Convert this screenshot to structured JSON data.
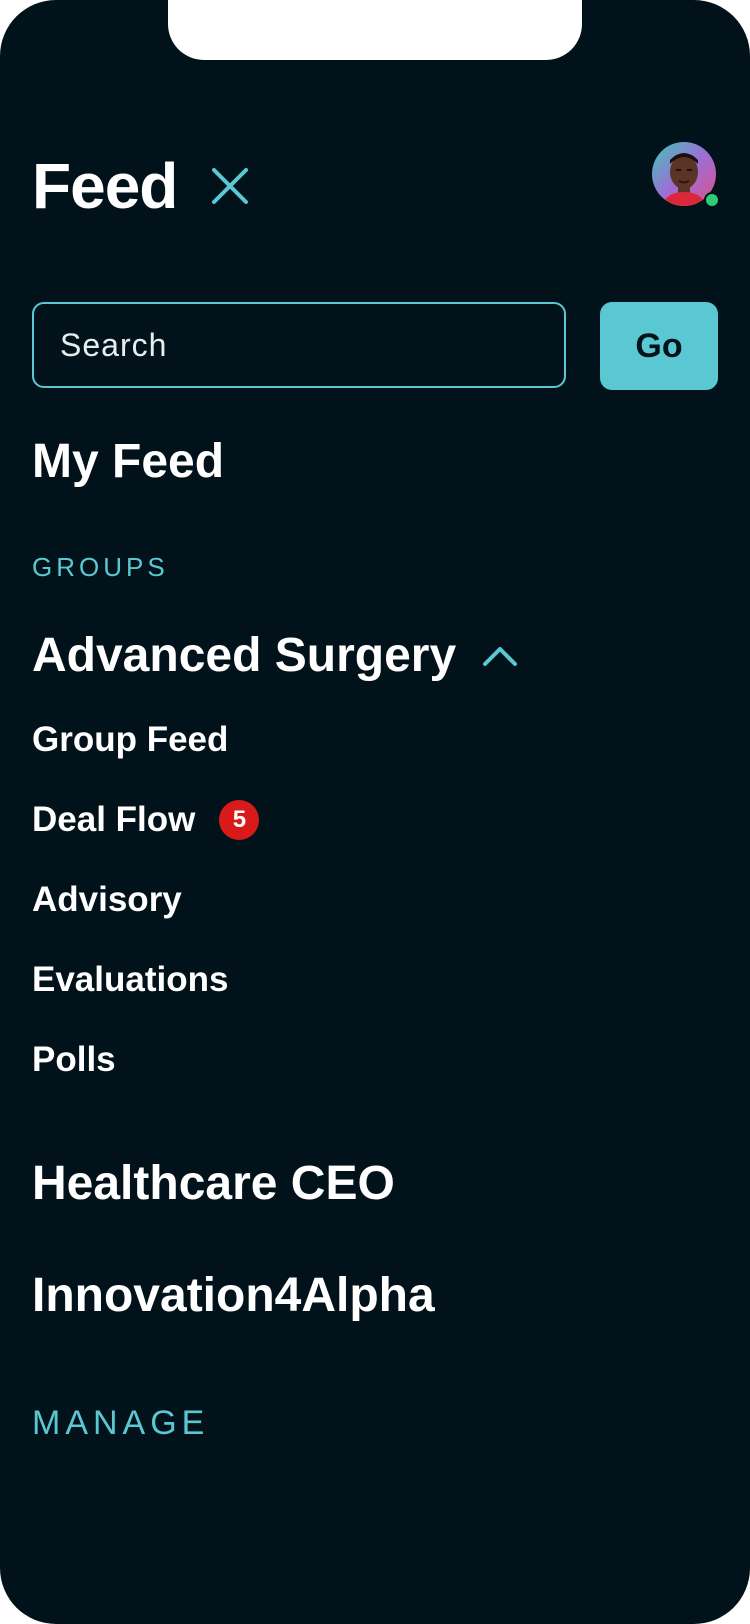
{
  "header": {
    "title": "Feed",
    "close_icon": "close-icon",
    "avatar": {
      "icon": "user-avatar",
      "status": "online",
      "status_color": "#2ecc71"
    }
  },
  "search": {
    "placeholder": "Search",
    "value": "",
    "button_label": "Go"
  },
  "nav": {
    "my_feed": "My Feed",
    "groups_label": "GROUPS",
    "groups": [
      {
        "label": "Advanced Surgery",
        "expanded": true,
        "chevron_icon": "chevron-up-icon",
        "items": [
          {
            "label": "Group Feed"
          },
          {
            "label": "Deal Flow",
            "badge": "5"
          },
          {
            "label": "Advisory"
          },
          {
            "label": "Evaluations"
          },
          {
            "label": "Polls"
          }
        ]
      },
      {
        "label": "Healthcare CEO",
        "expanded": false
      },
      {
        "label": "Innovation4Alpha",
        "expanded": false
      }
    ],
    "manage_label": "MANAGE"
  },
  "colors": {
    "background": "#02121a",
    "accent": "#5ac8d2",
    "badge": "#d91a1a",
    "text": "#ffffff"
  }
}
